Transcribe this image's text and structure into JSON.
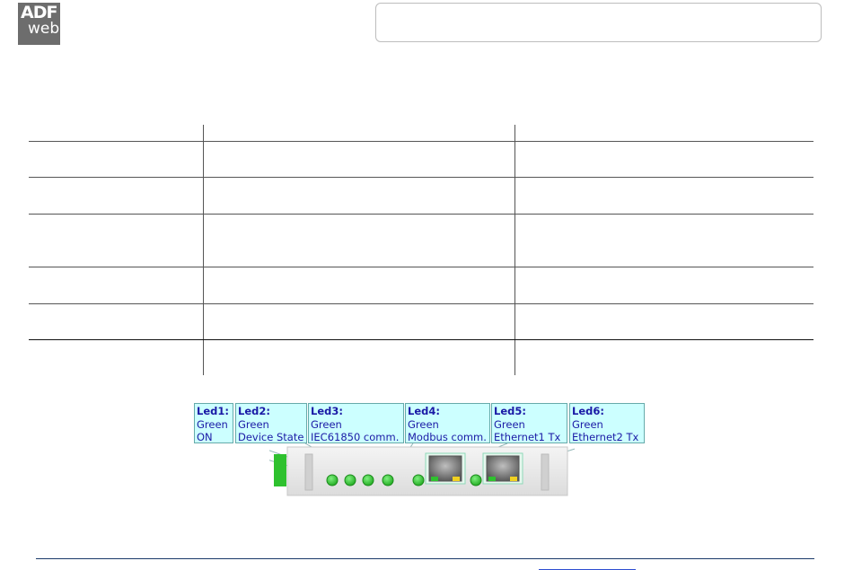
{
  "logo": {
    "line1": "ADF",
    "line2": "web"
  },
  "leds": [
    {
      "name": "Led1:",
      "color": "Green",
      "desc": "ON"
    },
    {
      "name": "Led2:",
      "color": "Green",
      "desc": "Device State"
    },
    {
      "name": "Led3:",
      "color": "Green",
      "desc": "IEC61850 comm."
    },
    {
      "name": "Led4:",
      "color": "Green",
      "desc": "Modbus comm."
    },
    {
      "name": "Led5:",
      "color": "Green",
      "desc": "Ethernet1 Tx"
    },
    {
      "name": "Led6:",
      "color": "Green",
      "desc": "Ethernet2 Tx"
    }
  ],
  "colors": {
    "led_green": "#2fc12f",
    "label_bg": "#ccffff",
    "label_text": "#1a1aa6",
    "device_body": "#e8e8e8"
  }
}
